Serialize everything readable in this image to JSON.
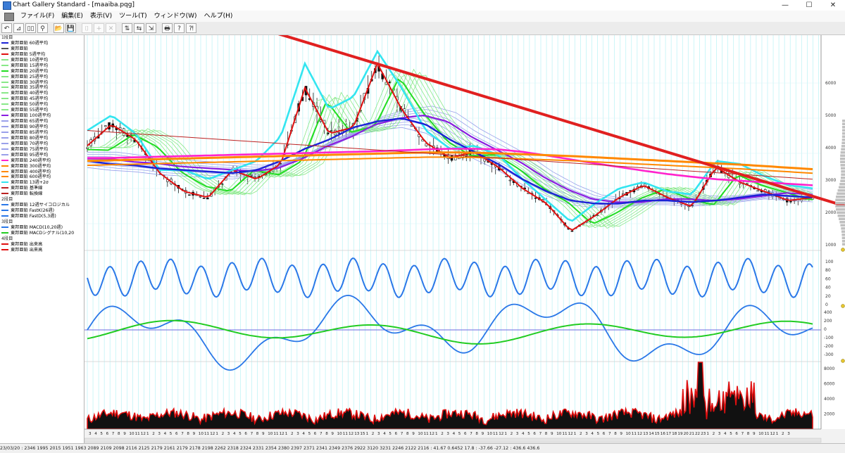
{
  "window": {
    "title": "Chart Gallery Standard - [maaiba.pqg]",
    "buttons": [
      "—",
      "☐",
      "✕"
    ]
  },
  "menu": [
    "ファイル(F)",
    "編集(E)",
    "表示(V)",
    "ツール(T)",
    "ウィンドウ(W)",
    "ヘルプ(H)"
  ],
  "toolbar": {
    "buttons": [
      "↶",
      "⊿",
      "▯▯",
      "⚲",
      "📂",
      "💾",
      "⌷",
      "+",
      "✕",
      "⇅",
      "⇆",
      "⇲",
      "🖶",
      "?",
      "⁈"
    ]
  },
  "legend": {
    "sections": [
      {
        "header": "1段目",
        "items": [
          {
            "label": "東邦亜鉛  60週平均",
            "color": "#1c22d6"
          },
          {
            "label": "東邦亜鉛",
            "color": "#555555"
          },
          {
            "label": "東邦亜鉛  5週平均",
            "color": "#e01010"
          },
          {
            "label": "東邦亜鉛  10週平均",
            "color": "#88e888"
          },
          {
            "label": "東邦亜鉛  15週平均",
            "color": "#88e888"
          },
          {
            "label": "東邦亜鉛  20週平均",
            "color": "#22dd22"
          },
          {
            "label": "東邦亜鉛  25週平均",
            "color": "#88e888"
          },
          {
            "label": "東邦亜鉛  30週平均",
            "color": "#88e888"
          },
          {
            "label": "東邦亜鉛  35週平均",
            "color": "#88e888"
          },
          {
            "label": "東邦亜鉛  40週平均",
            "color": "#88e888"
          },
          {
            "label": "東邦亜鉛  45週平均",
            "color": "#88e888"
          },
          {
            "label": "東邦亜鉛  50週平均",
            "color": "#88e888"
          },
          {
            "label": "東邦亜鉛  55週平均",
            "color": "#88e888"
          },
          {
            "label": "東邦亜鉛  100週平均",
            "color": "#8a1ee0"
          },
          {
            "label": "東邦亜鉛  65週平均",
            "color": "#9aa0ea"
          },
          {
            "label": "東邦亜鉛  90週平均",
            "color": "#9aa0ea"
          },
          {
            "label": "東邦亜鉛  85週平均",
            "color": "#9aa0ea"
          },
          {
            "label": "東邦亜鉛  80週平均",
            "color": "#9aa0ea"
          },
          {
            "label": "東邦亜鉛  70週平均",
            "color": "#9aa0ea"
          },
          {
            "label": "東邦亜鉛  75週平均",
            "color": "#9aa0ea"
          },
          {
            "label": "東邦亜鉛  95週平均",
            "color": "#9aa0ea"
          },
          {
            "label": "東邦亜鉛  240週平均",
            "color": "#ff22cc"
          },
          {
            "label": "東邦亜鉛  300週平均",
            "color": "#ff8800"
          },
          {
            "label": "東邦亜鉛  400週平均",
            "color": "#ff8800"
          },
          {
            "label": "東邦亜鉛  600週平均",
            "color": "#ff8800"
          },
          {
            "label": "東邦亜鉛  13週+2σ",
            "color": "#33e5f0"
          },
          {
            "label": "東邦亜鉛  基準線",
            "color": "#bb2222"
          },
          {
            "label": "東邦亜鉛  転換線",
            "color": "#bb2222"
          }
        ]
      },
      {
        "header": "2段目",
        "items": [
          {
            "label": "東邦亜鉛  12週サイコロジカル",
            "color": "#2a78e8"
          },
          {
            "label": "東邦亜鉛  FastK(26週)",
            "color": "#2a78e8"
          },
          {
            "label": "東邦亜鉛  FastD(5,3週)",
            "color": "#2a78e8"
          }
        ]
      },
      {
        "header": "3段目",
        "items": [
          {
            "label": "東邦亜鉛  MACD(10,20週)",
            "color": "#2a78e8"
          },
          {
            "label": "東邦亜鉛  MACDシグナル(10,20",
            "color": "#22cc22"
          }
        ]
      },
      {
        "header": "4段目",
        "items": [
          {
            "label": "東邦亜鉛  出来高",
            "color": "#e01010"
          },
          {
            "label": "東邦亜鉛  出来高",
            "color": "#e01010"
          }
        ]
      }
    ]
  },
  "axis": {
    "price_ticks": [
      "6000",
      "5000",
      "4000",
      "3000",
      "2000",
      "1000"
    ],
    "osc_ticks": [
      "100",
      "80",
      "60",
      "40",
      "20",
      "0"
    ],
    "macd_ticks": [
      "400",
      "200",
      "0",
      "-100",
      "-200",
      "-300"
    ],
    "volume_ticks": [
      "8000",
      "6000",
      "4000",
      "2000"
    ],
    "x_ticks": [
      "3",
      "4",
      "5",
      "6",
      "7",
      "8",
      "9",
      "10",
      "11",
      "12",
      "1",
      "2",
      "3",
      "4",
      "5",
      "6",
      "7",
      "8",
      "9",
      "10",
      "11",
      "12",
      "1",
      "2",
      "3",
      "4",
      "5",
      "6",
      "7",
      "8",
      "9",
      "10",
      "11",
      "12",
      "1",
      "2",
      "3",
      "4",
      "5",
      "6",
      "7",
      "8",
      "9",
      "10",
      "11",
      "12",
      "13",
      "15",
      "1",
      "2",
      "3",
      "4",
      "5",
      "6",
      "7",
      "8",
      "9",
      "10",
      "11",
      "12",
      "1",
      "2",
      "3",
      "4",
      "5",
      "6",
      "7",
      "8",
      "9",
      "10",
      "11",
      "12",
      "1",
      "2",
      "3",
      "4",
      "5",
      "6",
      "7",
      "8",
      "9",
      "10",
      "11",
      "12",
      "1",
      "2",
      "3",
      "4",
      "5",
      "6",
      "7",
      "8",
      "9",
      "10",
      "11",
      "12",
      "13",
      "14",
      "15",
      "16",
      "17",
      "18",
      "19",
      "20",
      "21",
      "22",
      "23",
      "1",
      "2",
      "3",
      "4",
      "5",
      "6",
      "7",
      "8",
      "9",
      "10",
      "11",
      "12",
      "1",
      "2",
      "3"
    ]
  },
  "status": {
    "text": "23/03/20 : 2346 1995 2015 1951 1963    2089 2109 2098 2116 2125 2179 2161 2179 2178 2198 2262 2318 2324 2331 2354 2380 2397 2371 2341 2349 2376 2922 3120 3231 2246 2122 2116 : 41.67 0.6452 17.8 : -37.66 -27.12 : 436.6 436.6"
  },
  "chart_data": {
    "type": "line",
    "title": "",
    "series": [
      {
        "name": "東邦亜鉛  5週平均",
        "values": [
          4100,
          4800,
          4300,
          3200,
          2600,
          2400,
          3300,
          3000,
          3500,
          6000,
          4500,
          4700,
          6800,
          5300,
          4200,
          3700,
          3900,
          3400,
          2700,
          2200,
          1300,
          1800,
          2400,
          2800,
          2400,
          2100,
          3400,
          2900,
          2600,
          2300,
          2400
        ]
      },
      {
        "name": "東邦亜鉛  13週+2σ",
        "values": [
          4600,
          5100,
          4500,
          3300,
          3300,
          3000,
          3300,
          3600,
          4400,
          6800,
          5300,
          5700,
          7200,
          6000,
          4600,
          4000,
          4100,
          3800,
          3000,
          2300,
          1600,
          2200,
          2700,
          2900,
          2600,
          2500,
          3600,
          3500,
          3100,
          2800,
          2700
        ]
      },
      {
        "name": "東邦亜鉛  60週平均",
        "values": [
          3600,
          3500,
          3450,
          3350,
          3300,
          3250,
          3200,
          3300,
          3600,
          4000,
          4300,
          4700,
          4900,
          5000,
          4800,
          4300,
          3900,
          3500,
          3000,
          2600,
          2300,
          2200,
          2200,
          2300,
          2300,
          2250,
          2300,
          2400,
          2500,
          2450,
          2400
        ]
      },
      {
        "name": "東邦亜鉛  240週平均",
        "values": [
          3700,
          3700,
          3720,
          3740,
          3760,
          3780,
          3800,
          3820,
          3840,
          3860,
          3880,
          3900,
          3920,
          3950,
          3980,
          4000,
          4000,
          3980,
          3900,
          3780,
          3650,
          3520,
          3400,
          3280,
          3170,
          3080,
          3000,
          2950,
          2900,
          2850,
          2800
        ]
      },
      {
        "name": "東邦亜鉛  300週平均",
        "values": [
          3600,
          3620,
          3640,
          3660,
          3680,
          3700,
          3720,
          3740,
          3760,
          3780,
          3800,
          3820,
          3840,
          3860,
          3880,
          3880,
          3870,
          3850,
          3820,
          3790,
          3760,
          3720,
          3680,
          3640,
          3600,
          3560,
          3520,
          3480,
          3430,
          3380,
          3330
        ]
      }
    ],
    "ylim": [
      800,
      7500
    ]
  },
  "trendline": {
    "color": "#e02020"
  }
}
